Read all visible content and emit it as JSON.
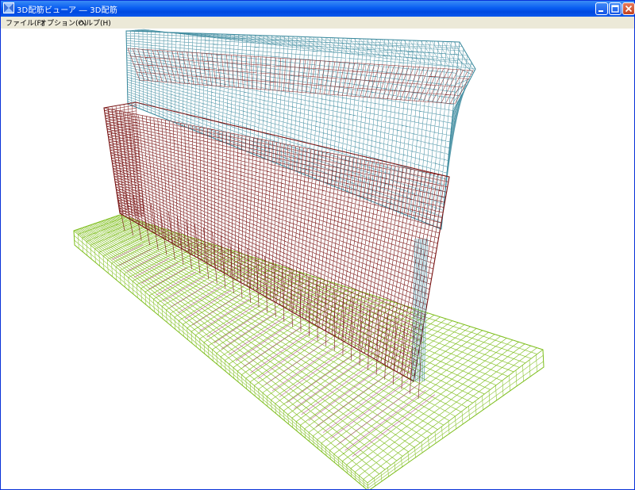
{
  "window": {
    "title": "3D配筋ビューア ― 3D配筋"
  },
  "menu": {
    "items": [
      {
        "label": "ファイル(F)"
      },
      {
        "label": "オプション(O)"
      },
      {
        "label": "ヘルプ(H)"
      }
    ]
  },
  "colors": {
    "titlebar": "#0a5ef2",
    "menubar": "#ece9d8",
    "footing_rebar": "#7fbf1f",
    "footing_stirrup": "#b64f8c",
    "wall_rebar": "#7a1616",
    "parapet_rebar": "#3c8a9e"
  },
  "icons": [
    "app-icon",
    "minimize-icon",
    "maximize-icon",
    "close-icon"
  ]
}
